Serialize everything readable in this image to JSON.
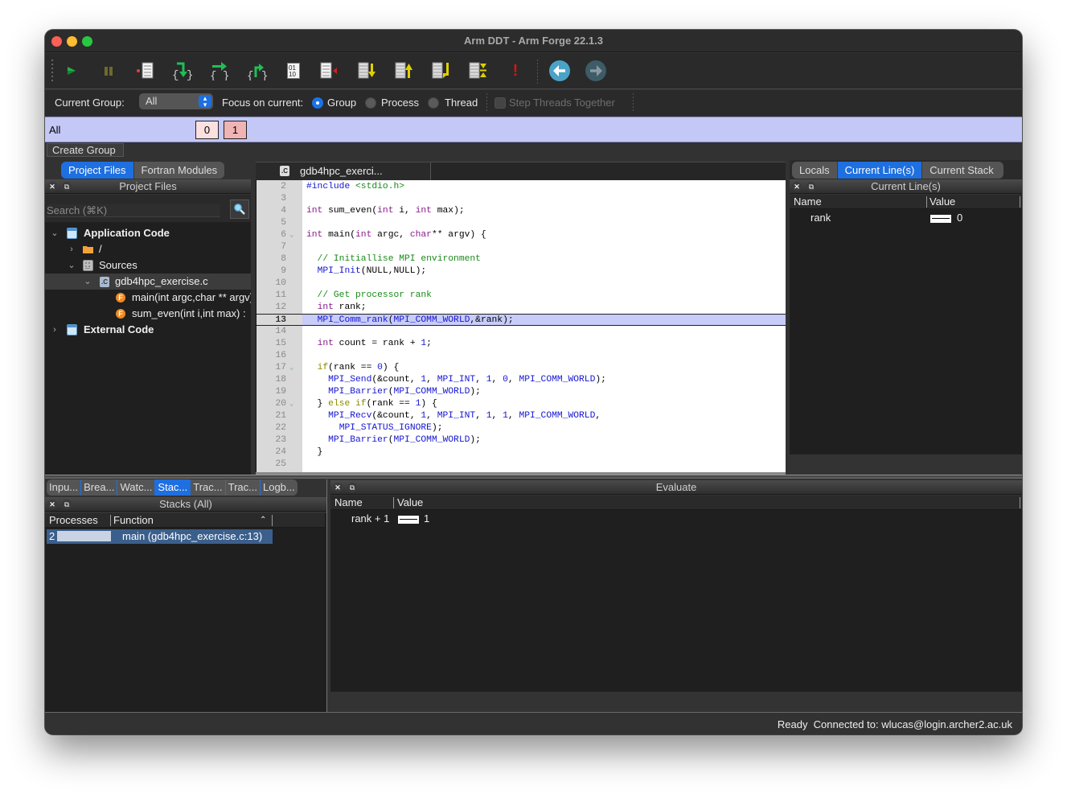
{
  "window": {
    "title": "Arm DDT - Arm Forge 22.1.3"
  },
  "toolbar": {
    "buttons": [
      {
        "name": "play-icon",
        "tooltip": "Play/Continue"
      },
      {
        "name": "pause-icon",
        "tooltip": "Pause"
      },
      {
        "name": "add-breakpoint-icon",
        "tooltip": "Add Breakpoint"
      },
      {
        "name": "step-into-icon",
        "tooltip": "Step Into"
      },
      {
        "name": "step-over-icon",
        "tooltip": "Step Over"
      },
      {
        "name": "step-out-icon",
        "tooltip": "Step Out"
      },
      {
        "name": "step-instruction-icon",
        "tooltip": "Step Instruction",
        "text": "01\n10"
      },
      {
        "name": "run-to-line-icon",
        "tooltip": "Run To Line"
      },
      {
        "name": "down-frame-icon",
        "tooltip": "Down Stack Frame"
      },
      {
        "name": "up-frame-icon",
        "tooltip": "Up Stack Frame"
      },
      {
        "name": "bottom-frame-icon",
        "tooltip": "Bottom Stack Frame"
      },
      {
        "name": "align-frames-icon",
        "tooltip": "Align Stack Frames"
      },
      {
        "name": "error-icon",
        "tooltip": "Error",
        "text": "!"
      },
      {
        "name": "back-icon",
        "tooltip": "Back"
      },
      {
        "name": "forward-icon",
        "tooltip": "Forward"
      }
    ]
  },
  "focus": {
    "current_group_label": "Current Group:",
    "current_group_value": "All",
    "focus_label": "Focus on current:",
    "options": [
      "Group",
      "Process",
      "Thread"
    ],
    "selected": "Group",
    "step_threads_label": "Step Threads Together",
    "step_threads_checked": false
  },
  "group": {
    "name": "All",
    "processes": [
      "0",
      "1"
    ],
    "create_group_label": "Create Group"
  },
  "left_panel": {
    "tabs": [
      "Project Files",
      "Fortran Modules"
    ],
    "active_tab": "Project Files",
    "title": "Project Files",
    "search_placeholder": "Search (⌘K)",
    "tree": [
      {
        "label": "Application Code",
        "level": 0,
        "expanded": true,
        "bold": true,
        "icon": "code-group-icon"
      },
      {
        "label": "/",
        "level": 1,
        "expanded": false,
        "icon": "folder-icon"
      },
      {
        "label": "Sources",
        "level": 1,
        "expanded": true,
        "icon": "sources-icon"
      },
      {
        "label": "gdb4hpc_exercise.c",
        "level": 2,
        "expanded": true,
        "selected": true,
        "icon": "c-file-icon"
      },
      {
        "label": "main(int argc,char ** argv)",
        "level": 3,
        "icon": "function-icon"
      },
      {
        "label": "sum_even(int i,int max) :",
        "level": 3,
        "icon": "function-icon"
      },
      {
        "label": "External Code",
        "level": 0,
        "expanded": false,
        "bold": true,
        "icon": "code-group-icon"
      }
    ]
  },
  "editor": {
    "tab_label": "gdb4hpc_exerci...",
    "current_line": 13,
    "lines": [
      {
        "n": 2,
        "code": "#include <stdio.h>"
      },
      {
        "n": 3,
        "code": ""
      },
      {
        "n": 4,
        "code": "int sum_even(int i, int max);"
      },
      {
        "n": 5,
        "code": ""
      },
      {
        "n": 6,
        "code": "int main(int argc, char** argv) {",
        "fold": true
      },
      {
        "n": 7,
        "code": ""
      },
      {
        "n": 8,
        "code": "  // Initiallise MPI environment"
      },
      {
        "n": 9,
        "code": "  MPI_Init(NULL,NULL);"
      },
      {
        "n": 10,
        "code": ""
      },
      {
        "n": 11,
        "code": "  // Get processor rank"
      },
      {
        "n": 12,
        "code": "  int rank;"
      },
      {
        "n": 13,
        "code": "  MPI_Comm_rank(MPI_COMM_WORLD,&rank);"
      },
      {
        "n": 14,
        "code": ""
      },
      {
        "n": 15,
        "code": "  int count = rank + 1;"
      },
      {
        "n": 16,
        "code": ""
      },
      {
        "n": 17,
        "code": "  if(rank == 0) {",
        "fold": true
      },
      {
        "n": 18,
        "code": "    MPI_Send(&count, 1, MPI_INT, 1, 0, MPI_COMM_WORLD);"
      },
      {
        "n": 19,
        "code": "    MPI_Barrier(MPI_COMM_WORLD);"
      },
      {
        "n": 20,
        "code": "  } else if(rank == 1) {",
        "fold": true
      },
      {
        "n": 21,
        "code": "    MPI_Recv(&count, 1, MPI_INT, 1, 1, MPI_COMM_WORLD,"
      },
      {
        "n": 22,
        "code": "      MPI_STATUS_IGNORE);"
      },
      {
        "n": 23,
        "code": "    MPI_Barrier(MPI_COMM_WORLD);"
      },
      {
        "n": 24,
        "code": "  }"
      },
      {
        "n": 25,
        "code": ""
      }
    ]
  },
  "right_panel": {
    "tabs": [
      "Locals",
      "Current Line(s)",
      "Current Stack"
    ],
    "active_tab": "Current Line(s)",
    "title": "Current Line(s)",
    "columns": [
      "Name",
      "Value"
    ],
    "rows": [
      {
        "name": "rank",
        "value": "0"
      }
    ]
  },
  "bottom_left": {
    "tabs": [
      "Inpu...",
      "Brea...",
      "Watc...",
      "Stac...",
      "Trac...",
      "Trac...",
      "Logb..."
    ],
    "active_tab": "Stac...",
    "title": "Stacks (All)",
    "columns": [
      "Processes",
      "Function"
    ],
    "rows": [
      {
        "processes": "2",
        "function": "main (gdb4hpc_exercise.c:13)"
      }
    ]
  },
  "evaluate": {
    "title": "Evaluate",
    "columns": [
      "Name",
      "Value"
    ],
    "rows": [
      {
        "name": "rank + 1",
        "value": "1"
      }
    ]
  },
  "status": {
    "text": "Ready  Connected to: wlucas@login.archer2.ac.uk"
  },
  "colors": {
    "accent": "#1e6fe0",
    "group_bar": "#c3c8f7",
    "current_line": "#c7ccf9"
  }
}
